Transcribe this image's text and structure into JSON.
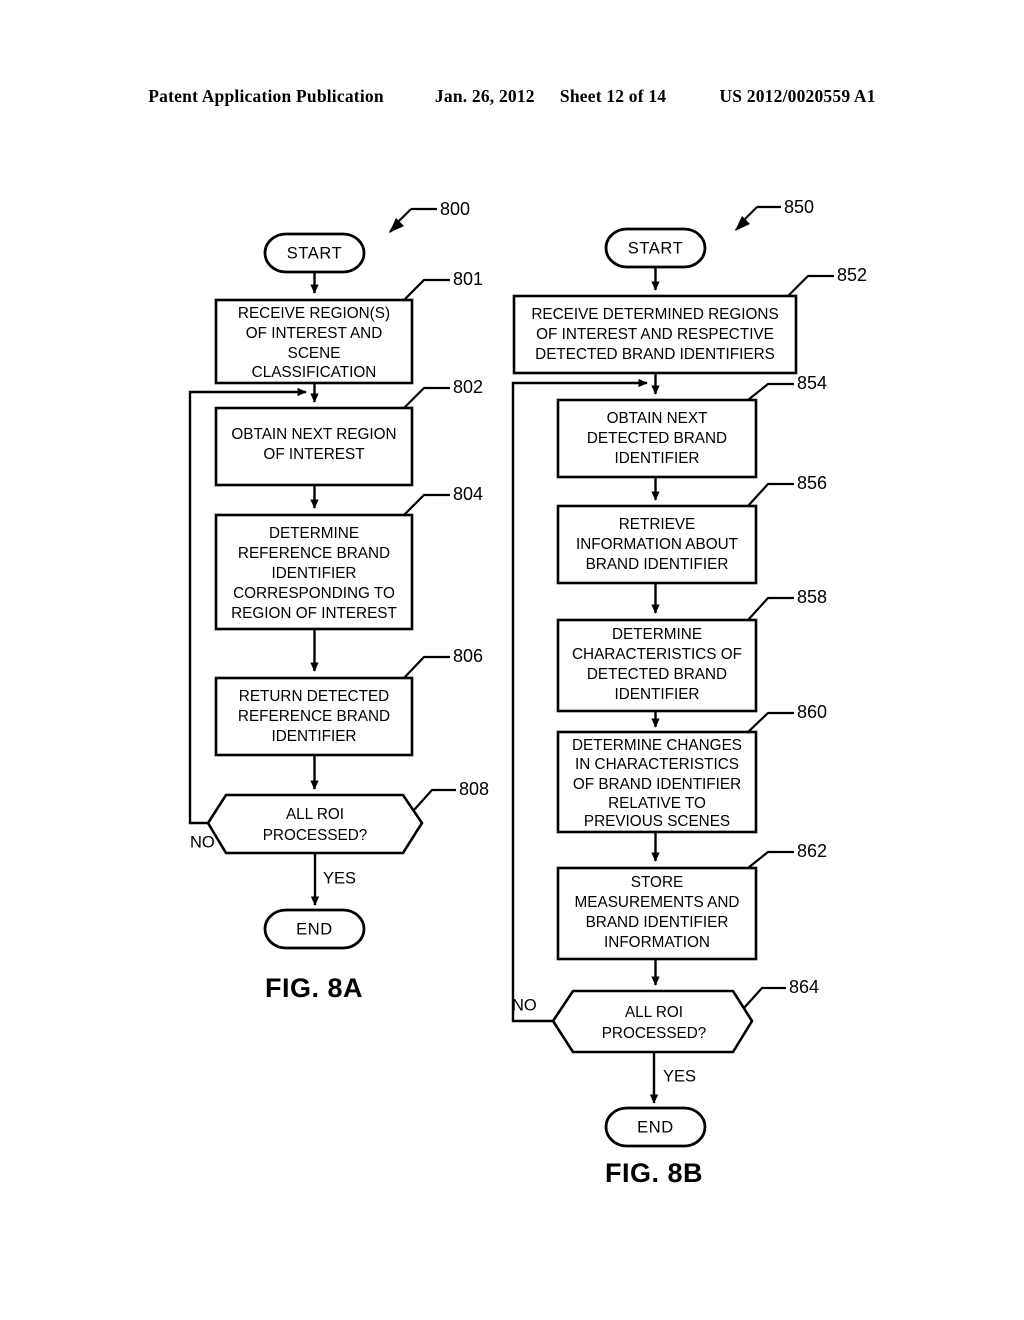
{
  "header": {
    "publication": "Patent Application Publication",
    "date": "Jan. 26, 2012",
    "sheet": "Sheet 12 of 14",
    "number": "US 2012/0020559 A1"
  },
  "figures": [
    {
      "caption": "FIG. 8A",
      "ref": "800",
      "nodes": [
        {
          "id": "start_a",
          "ref": "",
          "type": "terminal",
          "lines": [
            "START"
          ]
        },
        {
          "id": "n801",
          "ref": "801",
          "type": "process",
          "lines": [
            "RECEIVE REGION(S)",
            "OF INTEREST AND",
            "SCENE",
            "CLASSIFICATION"
          ]
        },
        {
          "id": "n802",
          "ref": "802",
          "type": "process",
          "lines": [
            "OBTAIN NEXT REGION",
            "OF INTEREST"
          ]
        },
        {
          "id": "n804",
          "ref": "804",
          "type": "process",
          "lines": [
            "DETERMINE",
            "REFERENCE BRAND",
            "IDENTIFIER",
            "CORRESPONDING TO",
            "REGION OF INTEREST"
          ]
        },
        {
          "id": "n806",
          "ref": "806",
          "type": "process",
          "lines": [
            "RETURN DETECTED",
            "REFERENCE BRAND",
            "IDENTIFIER"
          ]
        },
        {
          "id": "n808",
          "ref": "808",
          "type": "decision",
          "lines": [
            "ALL ROI",
            "PROCESSED?"
          ]
        },
        {
          "id": "end_a",
          "ref": "",
          "type": "terminal",
          "lines": [
            "END"
          ]
        }
      ],
      "branch_no": "NO",
      "branch_yes": "YES"
    },
    {
      "caption": "FIG. 8B",
      "ref": "850",
      "nodes": [
        {
          "id": "start_b",
          "ref": "",
          "type": "terminal",
          "lines": [
            "START"
          ]
        },
        {
          "id": "n852",
          "ref": "852",
          "type": "process",
          "lines": [
            "RECEIVE DETERMINED REGIONS",
            "OF INTEREST AND RESPECTIVE",
            "DETECTED BRAND IDENTIFIERS"
          ]
        },
        {
          "id": "n854",
          "ref": "854",
          "type": "process",
          "lines": [
            "OBTAIN NEXT",
            "DETECTED BRAND",
            "IDENTIFIER"
          ]
        },
        {
          "id": "n856",
          "ref": "856",
          "type": "process",
          "lines": [
            "RETRIEVE",
            "INFORMATION ABOUT",
            "BRAND IDENTIFIER"
          ]
        },
        {
          "id": "n858",
          "ref": "858",
          "type": "process",
          "lines": [
            "DETERMINE",
            "CHARACTERISTICS OF",
            "DETECTED BRAND",
            "IDENTIFIER"
          ]
        },
        {
          "id": "n860",
          "ref": "860",
          "type": "process",
          "lines": [
            "DETERMINE CHANGES",
            "IN CHARACTERISTICS",
            "OF BRAND IDENTIFIER",
            "RELATIVE TO",
            "PREVIOUS SCENES"
          ]
        },
        {
          "id": "n862",
          "ref": "862",
          "type": "process",
          "lines": [
            "STORE",
            "MEASUREMENTS AND",
            "BRAND IDENTIFIER",
            "INFORMATION"
          ]
        },
        {
          "id": "n864",
          "ref": "864",
          "type": "decision",
          "lines": [
            "ALL ROI",
            "PROCESSED?"
          ]
        },
        {
          "id": "end_b",
          "ref": "",
          "type": "terminal",
          "lines": [
            "END"
          ]
        }
      ],
      "branch_no": "NO",
      "branch_yes": "YES"
    }
  ]
}
